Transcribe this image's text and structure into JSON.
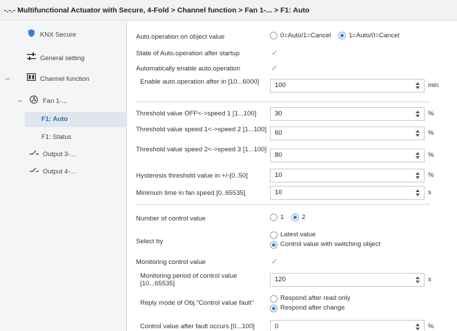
{
  "title": "-.-.- Multifunctional Actuator with Secure, 4-Fold > Channel function > Fan 1-... > F1: Auto",
  "sidebar": {
    "items": [
      {
        "label": "KNX Secure",
        "icon": "shield-icon"
      },
      {
        "label": "General setting",
        "icon": "sliders-icon"
      },
      {
        "label": "Channel function",
        "icon": "channel-icon"
      },
      {
        "label": "Fan 1-...",
        "icon": "fan-icon"
      },
      {
        "label": "F1: Auto"
      },
      {
        "label": "F1: Status"
      },
      {
        "label": "Output 3-...",
        "icon": "switch-icon"
      },
      {
        "label": "Output 4-...",
        "icon": "switch-icon"
      }
    ],
    "collapse_symbol": "–"
  },
  "params": {
    "auto_object": {
      "label": "Auto.operation on object value",
      "opt1": "0=Auto/1=Cancel",
      "opt2": "1=Auto/0=Cancel"
    },
    "state_startup": {
      "label": "State of Auto.operation after startup"
    },
    "auto_enable": {
      "label": "Automatically enable auto.operation"
    },
    "enable_after": {
      "label": "Enable auto.operation after in [10...6000]",
      "value": "100",
      "unit": "min"
    },
    "threshold_off": {
      "label": "Threshold value OFF<->speed 1 [1...100]",
      "value": "30",
      "unit": "%"
    },
    "threshold_12": {
      "label": "Threshold value speed 1<->speed 2 [1...100]",
      "value": "60",
      "unit": "%"
    },
    "threshold_23": {
      "label": "Threshold value speed 2<->speed 3 [1...100]",
      "value": "80",
      "unit": "%"
    },
    "hysteresis": {
      "label": "Hysteresis threshold value in +/-[0..50]",
      "value": "10",
      "unit": "%"
    },
    "min_time": {
      "label": "Minimum time in fan speed [0..65535]",
      "value": "10",
      "unit": "s"
    },
    "num_control": {
      "label": "Number of control value",
      "opt1": "1",
      "opt2": "2"
    },
    "select_by": {
      "label": "Select by",
      "opt1": "Latest value",
      "opt2": "Control value with switching object"
    },
    "monitoring": {
      "label": "Monitoring control value"
    },
    "monitor_period": {
      "label": "Monitoring period of control value [10...65535]",
      "value": "120",
      "unit": "s"
    },
    "reply_mode": {
      "label": "Reply mode of Obj.\"Control value fault\"",
      "opt1": "Respond after read only",
      "opt2": "Respond after change"
    },
    "after_fault": {
      "label": "Control value after fault occurs [0...100]",
      "value": "0",
      "unit": "%"
    }
  },
  "check_symbol": "✓"
}
